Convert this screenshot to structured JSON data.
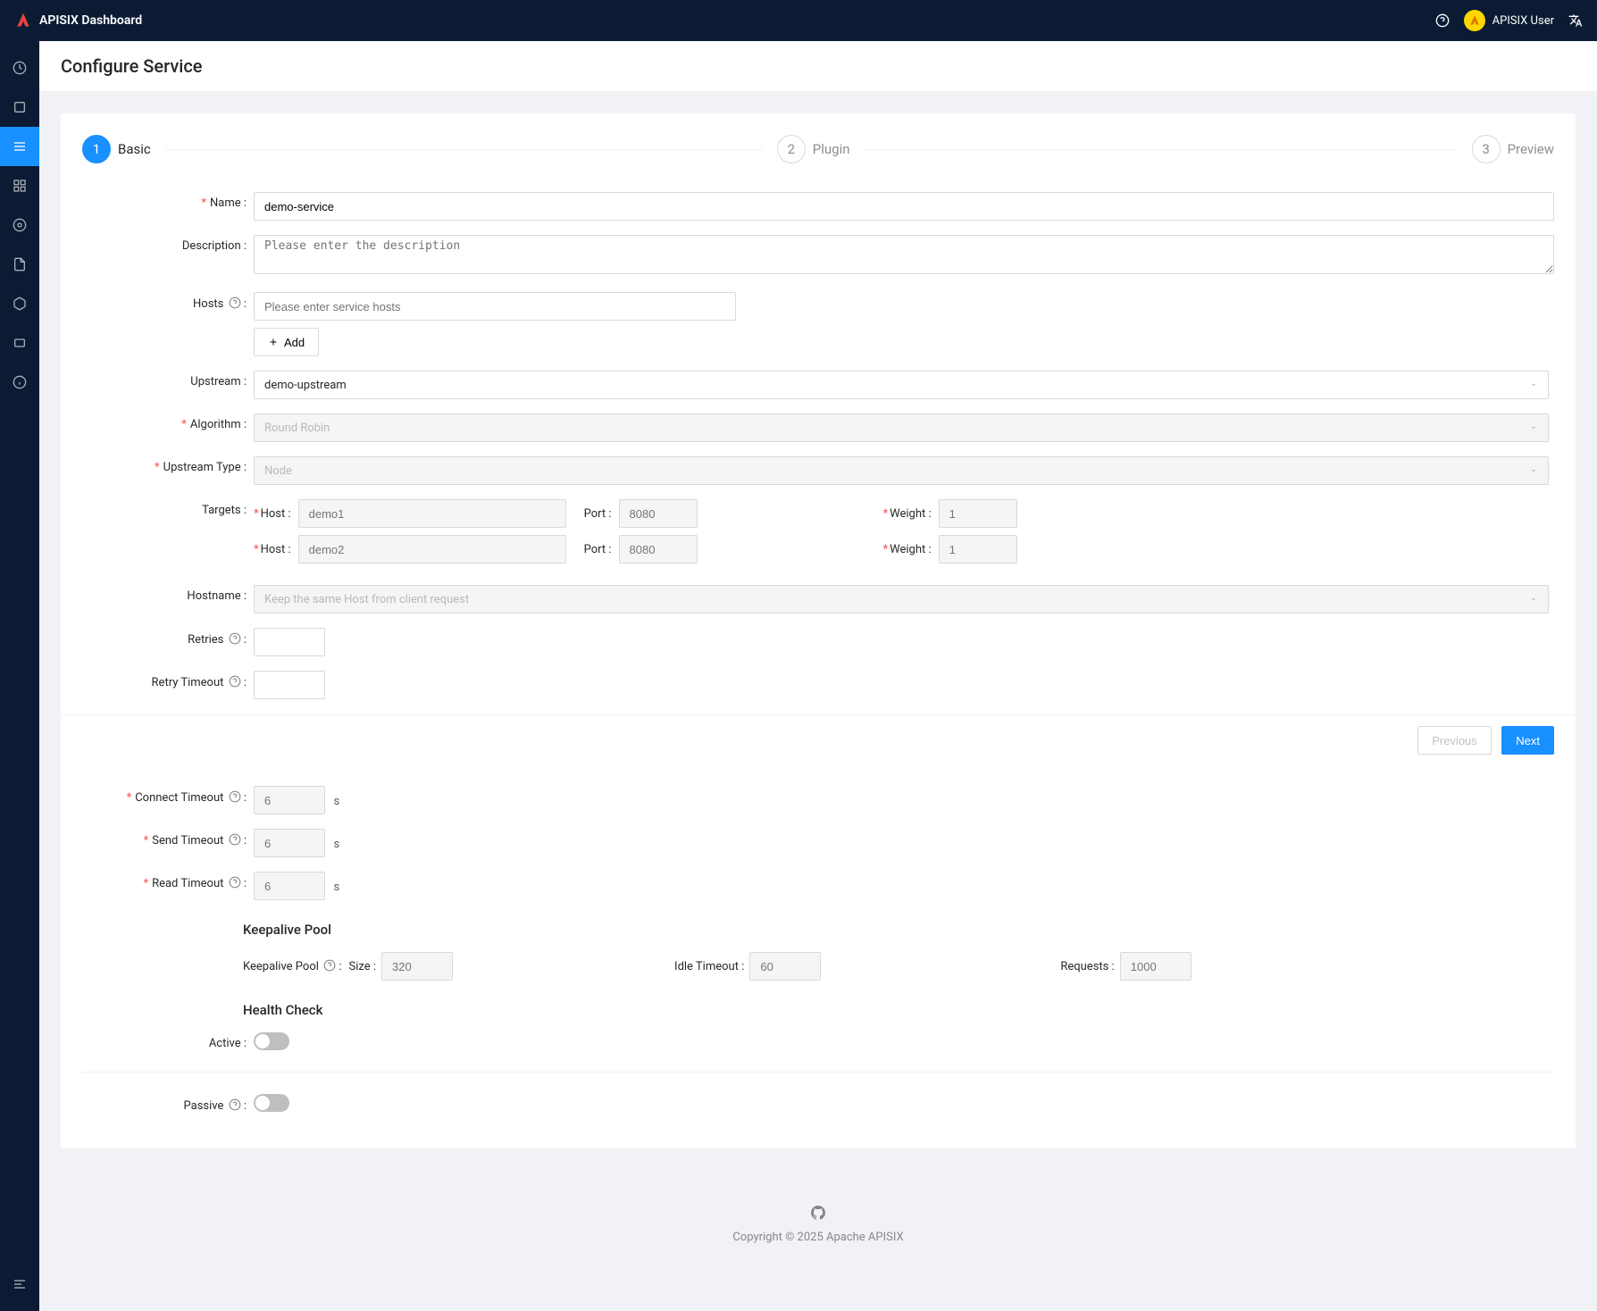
{
  "header": {
    "title": "APISIX Dashboard",
    "user_name": "APISIX User"
  },
  "page": {
    "title": "Configure Service"
  },
  "steps": {
    "s1": {
      "num": "1",
      "label": "Basic"
    },
    "s2": {
      "num": "2",
      "label": "Plugin"
    },
    "s3": {
      "num": "3",
      "label": "Preview"
    }
  },
  "form": {
    "name": {
      "label": "Name :",
      "value": "demo-service"
    },
    "description": {
      "label": "Description :",
      "placeholder": "Please enter the description",
      "value": ""
    },
    "hosts": {
      "label": "Hosts",
      "placeholder": "Please enter service hosts",
      "add_label": "Add"
    },
    "upstream": {
      "label": "Upstream :",
      "value": "demo-upstream"
    },
    "algorithm": {
      "label": "Algorithm :",
      "value": "Round Robin"
    },
    "upstream_type": {
      "label": "Upstream Type :",
      "value": "Node"
    },
    "targets": {
      "label": "Targets :",
      "host_label": "Host :",
      "port_label": "Port :",
      "weight_label": "Weight :",
      "rows": [
        {
          "host": "demo1",
          "port": "8080",
          "weight": "1"
        },
        {
          "host": "demo2",
          "port": "8080",
          "weight": "1"
        }
      ]
    },
    "hostname": {
      "label": "Hostname :",
      "value": "Keep the same Host from client request"
    },
    "retries": {
      "label": "Retries",
      "value": ""
    },
    "retry_timeout": {
      "label": "Retry Timeout",
      "value": ""
    },
    "connect_timeout": {
      "label": "Connect Timeout",
      "value": "6",
      "unit": "s"
    },
    "send_timeout": {
      "label": "Send Timeout",
      "value": "6",
      "unit": "s"
    },
    "read_timeout": {
      "label": "Read Timeout",
      "value": "6",
      "unit": "s"
    },
    "keepalive": {
      "title": "Keepalive Pool",
      "pool_label": "Keepalive Pool",
      "size_label": "Size :",
      "size_value": "320",
      "idle_label": "Idle Timeout :",
      "idle_value": "60",
      "req_label": "Requests :",
      "req_value": "1000"
    },
    "health": {
      "title": "Health Check",
      "active_label": "Active :",
      "passive_label": "Passive"
    }
  },
  "actions": {
    "previous": "Previous",
    "next": "Next"
  },
  "footer": {
    "copyright": "Copyright © 2025 Apache APISIX"
  }
}
